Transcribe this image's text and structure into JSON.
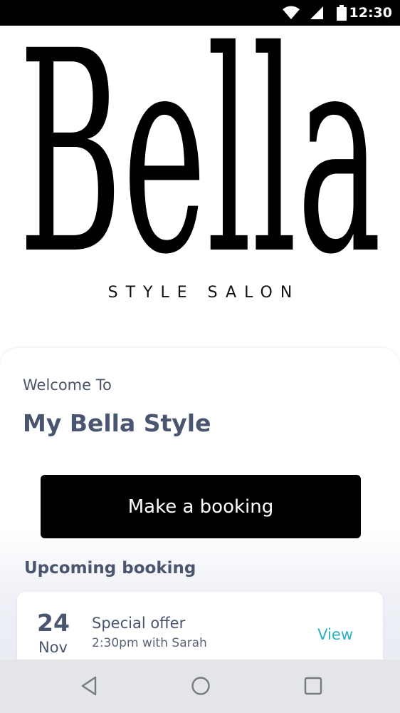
{
  "status_bar": {
    "time": "12:30",
    "icons": [
      "wifi-icon",
      "cellular-signal-icon",
      "battery-icon"
    ]
  },
  "logo": {
    "wordmark": "Bella",
    "subtitle": "STYLE SALON"
  },
  "welcome": {
    "greeting": "Welcome To",
    "app_name": "My Bella Style"
  },
  "actions": {
    "booking_button_label": "Make a booking"
  },
  "upcoming": {
    "section_title": "Upcoming booking",
    "bookings": [
      {
        "day": "24",
        "month": "Nov",
        "title": "Special offer",
        "details": "2:30pm with Sarah",
        "action_label": "View"
      }
    ]
  },
  "nav_bar": {
    "buttons": [
      "back-icon",
      "home-icon",
      "recents-icon"
    ]
  },
  "colors": {
    "primary_text": "#4a5570",
    "button_bg": "#000000",
    "link": "#2ab0c6",
    "status_bar_bg": "#000000",
    "nav_bar_bg": "#e4e5e8"
  }
}
